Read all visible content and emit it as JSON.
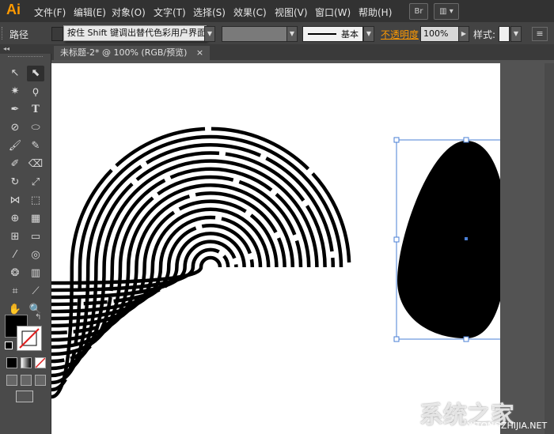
{
  "app": {
    "logo": "Ai"
  },
  "menu": [
    "文件(F)",
    "编辑(E)",
    "对象(O)",
    "文字(T)",
    "选择(S)",
    "效果(C)",
    "视图(V)",
    "窗口(W)",
    "帮助(H)"
  ],
  "topbar_buttons": [
    "Br",
    "▥ ▾"
  ],
  "control": {
    "path_label": "路径",
    "hint": "按住 Shift 键调出替代色彩用户界面",
    "stroke_style": "基本",
    "opacity_label": "不透明度",
    "opacity_value": "100%",
    "style_label": "样式:"
  },
  "document": {
    "tab_title": "未标题-2* @ 100% (RGB/预览)",
    "close": "×"
  },
  "tools": [
    "selection-tool",
    "direct-selection-tool",
    "magic-wand-tool",
    "lasso-tool",
    "pen-tool",
    "type-tool",
    "line-segment-tool",
    "ellipse-tool",
    "paintbrush-tool",
    "pencil-tool",
    "blob-brush-tool",
    "eraser-tool",
    "rotate-tool",
    "scale-tool",
    "width-tool",
    "free-transform-tool",
    "shape-builder-tool",
    "chart-tool",
    "mesh-tool",
    "gradient-tool",
    "eyedropper-tool",
    "blend-tool",
    "symbol-sprayer-tool",
    "column-graph-tool",
    "artboard-tool",
    "slice-tool",
    "hand-tool",
    "zoom-tool"
  ],
  "colors": {
    "accent": "#ff9a00",
    "selection": "#4a7fd6",
    "fill": "#000000",
    "stroke": "#ffffff"
  },
  "watermark": {
    "text": "系统之家",
    "url": "XITONGZHIJIA.NET"
  }
}
